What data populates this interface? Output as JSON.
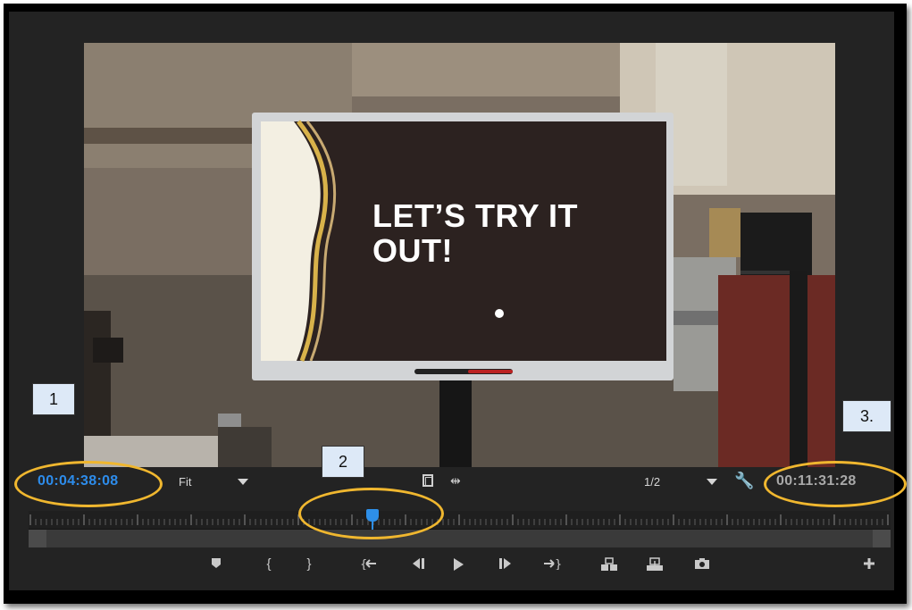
{
  "video_frame": {
    "slide_text": "LET’S TRY IT\nOUT!"
  },
  "timecodes": {
    "current": "00:04:38:08",
    "duration": "00:11:31:28"
  },
  "viewer_controls": {
    "zoom_value": "Fit",
    "resolution_value": "1/2"
  },
  "annotations": {
    "labels": [
      "1",
      "2",
      "3."
    ]
  },
  "transport_buttons": [
    {
      "icon": "add-marker-icon"
    },
    {
      "icon": "mark-in-icon"
    },
    {
      "icon": "mark-out-icon"
    },
    {
      "icon": "go-to-in-icon"
    },
    {
      "icon": "step-back-icon"
    },
    {
      "icon": "play-icon"
    },
    {
      "icon": "step-forward-icon"
    },
    {
      "icon": "go-to-out-icon"
    },
    {
      "icon": "insert-icon"
    },
    {
      "icon": "overwrite-icon"
    },
    {
      "icon": "export-frame-icon"
    },
    {
      "icon": "button-editor-icon"
    }
  ],
  "colors": {
    "panel_bg": "#232323",
    "current_time": "#2d8ceb",
    "duration_time": "#a9a9a9",
    "callout": "#f0b72f"
  }
}
